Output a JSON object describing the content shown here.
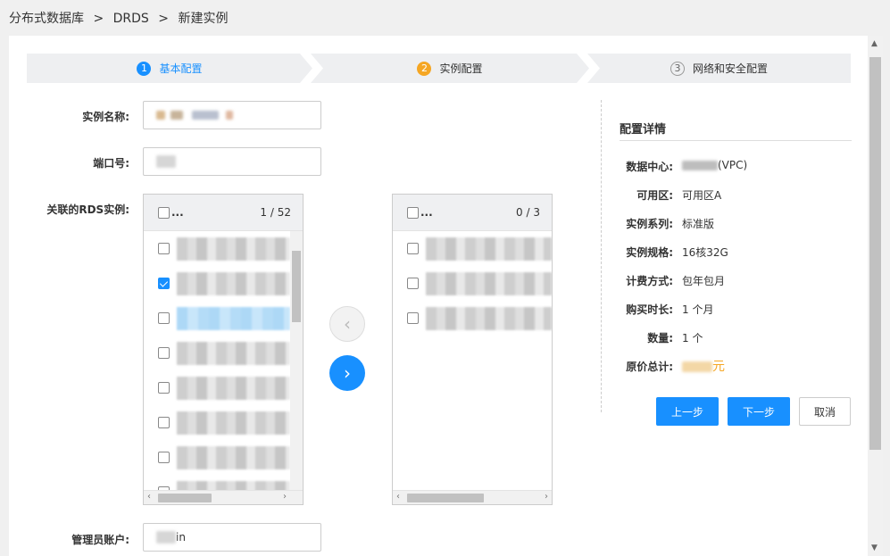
{
  "breadcrumb": {
    "root": "分布式数据库",
    "sep1": ">",
    "mid": "DRDS",
    "sep2": ">",
    "current": "新建实例"
  },
  "steps": [
    {
      "num": "1",
      "label": "基本配置"
    },
    {
      "num": "2",
      "label": "实例配置"
    },
    {
      "num": "3",
      "label": "网络和安全配置"
    }
  ],
  "form": {
    "instance_name_label": "实例名称:",
    "port_label": "端口号:",
    "rds_label": "关联的RDS实例:",
    "admin_label": "管理员账户:",
    "admin_value": "in"
  },
  "transfer": {
    "left_select_all": "...",
    "left_count": "1 / 52",
    "right_select_all": "...",
    "right_count": "0 / 3"
  },
  "summary": {
    "title": "配置详情",
    "rows": [
      {
        "key": "数据中心:",
        "value": "(VPC)"
      },
      {
        "key": "可用区:",
        "value": "可用区A"
      },
      {
        "key": "实例系列:",
        "value": "标准版"
      },
      {
        "key": "实例规格:",
        "value": "16核32G"
      },
      {
        "key": "计费方式:",
        "value": "包年包月"
      },
      {
        "key": "购买时长:",
        "value": "1 个月"
      },
      {
        "key": "数量:",
        "value": "1 个"
      },
      {
        "key": "原价总计:",
        "value": "元"
      }
    ]
  },
  "buttons": {
    "prev": "上一步",
    "next": "下一步",
    "cancel": "取消"
  },
  "icons": {
    "move_left": "chevron-left-icon",
    "move_right": "chevron-right-icon"
  },
  "colors": {
    "primary": "#1890ff",
    "warning": "#f5a623"
  }
}
